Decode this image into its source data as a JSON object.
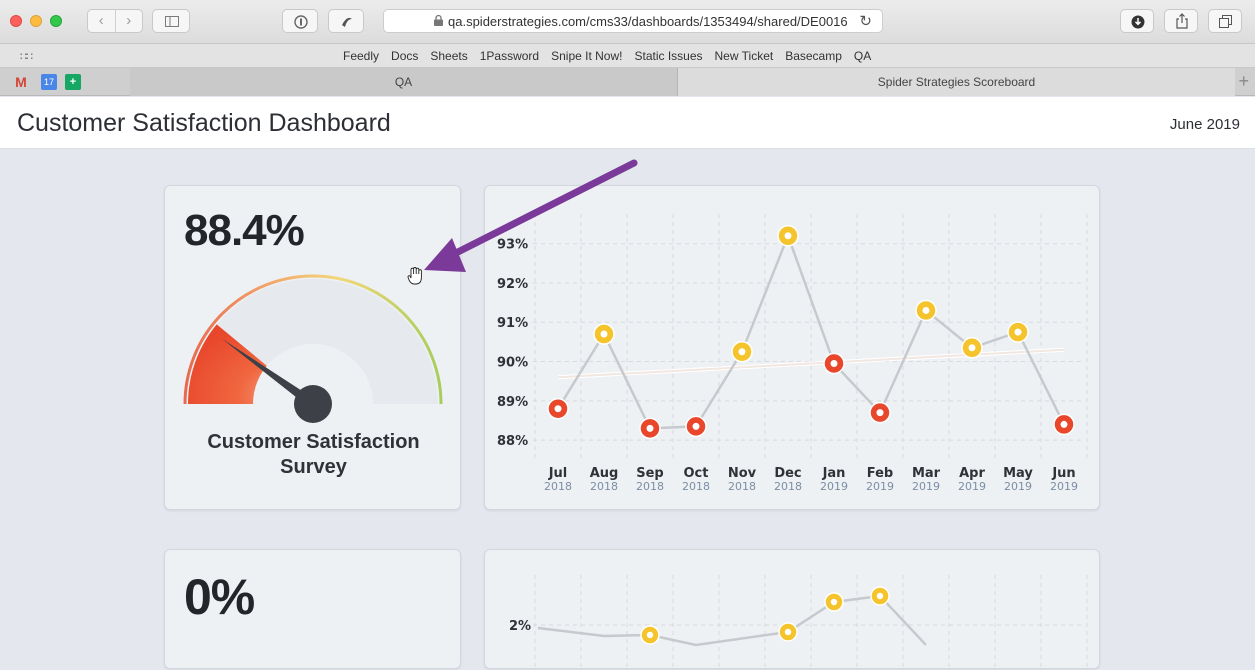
{
  "browser": {
    "url": "qa.spiderstrategies.com/cms33/dashboards/1353494/shared/DE0016",
    "bookmarks": [
      "Feedly",
      "Docs",
      "Sheets",
      "1Password",
      "Snipe It Now!",
      "Static Issues",
      "New Ticket",
      "Basecamp",
      "QA"
    ],
    "tabs": [
      {
        "label": "QA",
        "active": false
      },
      {
        "label": "Spider Strategies Scoreboard",
        "active": true
      }
    ],
    "pinned": {
      "gmail": "M",
      "calendar": "17",
      "sheets": "+"
    }
  },
  "dashboard": {
    "title": "Customer Satisfaction Dashboard",
    "period": "June 2019"
  },
  "kpi1": {
    "value": "88.4%",
    "gauge_fraction": 0.22,
    "title_line1": "Customer Satisfaction",
    "title_line2": "Survey"
  },
  "kpi2": {
    "value": "0%"
  },
  "colors": {
    "red": "#e8472c",
    "yellow": "#f5c42c",
    "green": "#a7cd5c",
    "arrow": "#7b3a9a",
    "trend": "#f2e6e0"
  },
  "chart_data": [
    {
      "type": "line",
      "categories": [
        "Jul",
        "Aug",
        "Sep",
        "Oct",
        "Nov",
        "Dec",
        "Jan",
        "Feb",
        "Mar",
        "Apr",
        "May",
        "Jun"
      ],
      "years": [
        "2018",
        "2018",
        "2018",
        "2018",
        "2018",
        "2018",
        "2019",
        "2019",
        "2019",
        "2019",
        "2019",
        "2019"
      ],
      "values": [
        88.8,
        90.7,
        88.3,
        88.35,
        90.25,
        93.2,
        89.95,
        88.7,
        91.3,
        90.35,
        90.75,
        88.4
      ],
      "status": [
        "red",
        "yellow",
        "red",
        "red",
        "yellow",
        "yellow",
        "red",
        "red",
        "yellow",
        "yellow",
        "yellow",
        "red"
      ],
      "trend": [
        89.6,
        90.3
      ],
      "ylim": [
        87.8,
        93.5
      ],
      "yticks": [
        88,
        89,
        90,
        91,
        92,
        93
      ],
      "ytick_labels": [
        "88%",
        "89%",
        "90%",
        "91%",
        "92%",
        "93%"
      ],
      "grid": true
    },
    {
      "type": "line",
      "yticks": [
        2
      ],
      "ytick_labels": [
        "2%"
      ],
      "grid": true
    }
  ]
}
